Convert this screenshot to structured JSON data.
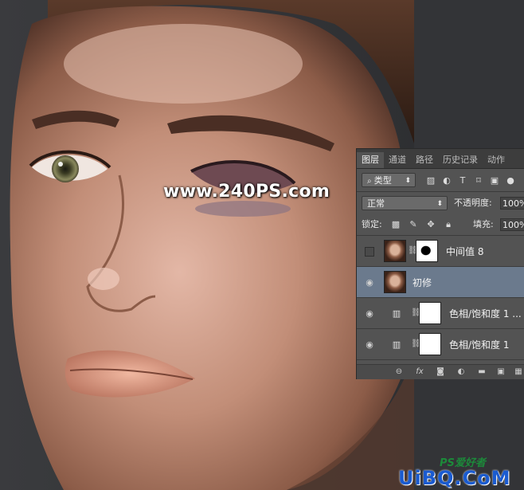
{
  "watermark": "www.240PS.com",
  "brand": {
    "top": "PS爱好者",
    "main": "UiBQ.CoM"
  },
  "panel": {
    "tabs": [
      "图层",
      "通道",
      "路径",
      "历史记录",
      "动作"
    ],
    "active_tab": "图层",
    "filter_kind": "类型",
    "blend_mode": "正常",
    "opacity_label": "不透明度:",
    "opacity_value": "100%",
    "lock_label": "锁定:",
    "fill_label": "填充:",
    "fill_value": "100%",
    "layers": [
      {
        "name": "中间值 8",
        "visible": false,
        "selected": false,
        "type": "pixel-with-mask"
      },
      {
        "name": "初修",
        "visible": true,
        "selected": true,
        "type": "pixel"
      },
      {
        "name": "色相/饱和度 1 ...",
        "visible": true,
        "selected": false,
        "type": "adjustment"
      },
      {
        "name": "色相/饱和度 1",
        "visible": true,
        "selected": false,
        "type": "adjustment"
      }
    ],
    "footer_icons": [
      "link-icon",
      "fx-icon",
      "add-mask-icon",
      "adjustment-icon",
      "group-folder-icon",
      "new-layer-icon",
      "trash-icon"
    ]
  }
}
